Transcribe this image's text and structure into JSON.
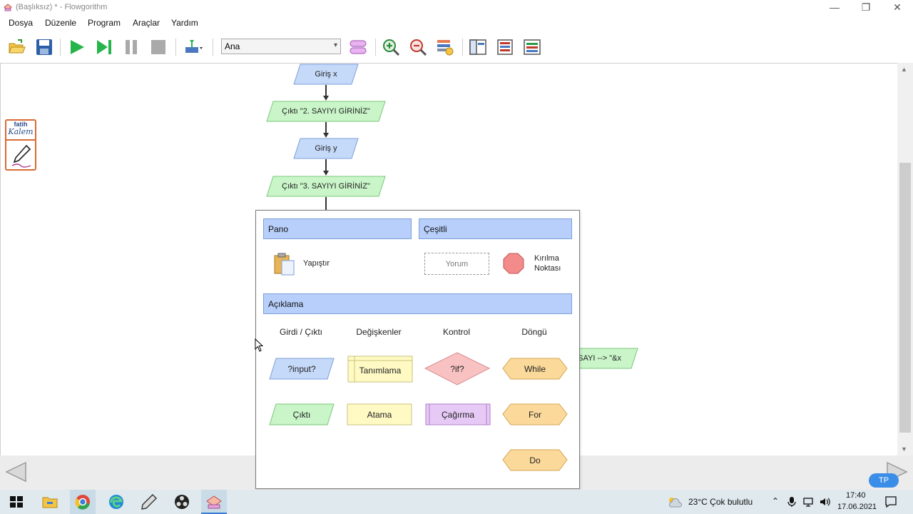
{
  "window": {
    "title": "(Başlıksız) * - Flowgorithm",
    "controls": {
      "minimize": "—",
      "maximize": "❐",
      "close": "✕"
    }
  },
  "menu": [
    "Dosya",
    "Düzenle",
    "Program",
    "Araçlar",
    "Yardım"
  ],
  "toolbar": {
    "function_select": "Ana",
    "buttons": [
      "open-icon",
      "save-icon",
      "run-icon",
      "step-icon",
      "pause-icon",
      "stop-icon",
      "run-options-icon",
      "layout-icon",
      "zoom-in-icon",
      "zoom-out-icon",
      "variables-icon",
      "window-layout-1-icon",
      "window-layout-2-icon",
      "window-layout-3-icon"
    ]
  },
  "flowchart": {
    "shapes": [
      {
        "type": "input",
        "text": "Giriş x"
      },
      {
        "type": "output",
        "text": "Çıktı \"2. SAYIYI GİRİNİZ\""
      },
      {
        "type": "input",
        "text": "Giriş y"
      },
      {
        "type": "output",
        "text": "Çıktı \"3. SAYIYI GİRİNİZ\""
      },
      {
        "type": "output",
        "text": "SAYI --> \"&x"
      }
    ]
  },
  "popup": {
    "sections": {
      "pano": "Pano",
      "cesitli": "Çeşitli",
      "aciklama": "Açıklama"
    },
    "pano_items": {
      "paste": "Yapıştır"
    },
    "cesitli_items": {
      "comment": "Yorum",
      "breakpoint_line1": "Kırılma",
      "breakpoint_line2": "Noktası"
    },
    "columns": [
      "Girdi / Çıktı",
      "Değişkenler",
      "Kontrol",
      "Döngü"
    ],
    "items": {
      "input": "?input?",
      "declare": "Tanımlama",
      "if": "?if?",
      "while": "While",
      "output": "Çıktı",
      "assign": "Atama",
      "call": "Çağırma",
      "for": "For",
      "do": "Do"
    }
  },
  "fatih": {
    "line1": "fatih",
    "line2": "Kalem"
  },
  "badge": "TP",
  "taskbar": {
    "weather": "23°C  Çok bulutlu",
    "time": "17:40",
    "date": "17.06.2021"
  },
  "colors": {
    "input": "#c5d9f9",
    "output": "#c9f5c9",
    "declare": "#fffac4",
    "if": "#f9c2c2",
    "loop": "#fbd99a",
    "call": "#e6c9f5",
    "header": "#b7cffa",
    "breakpoint": "#f48b8b"
  }
}
